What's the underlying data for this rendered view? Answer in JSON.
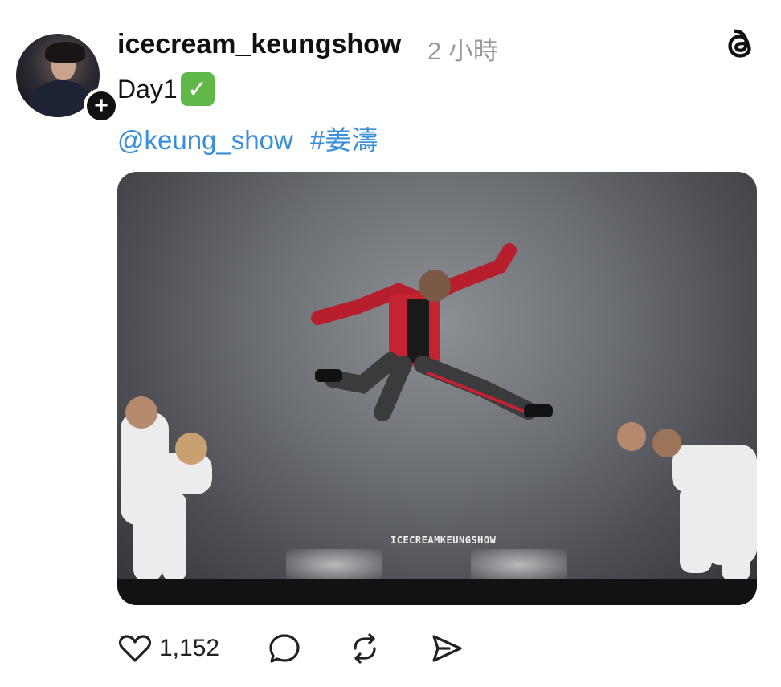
{
  "post": {
    "username": "icecream_keungshow",
    "timestamp": "2 小時",
    "caption": "Day1",
    "caption_emoji": "✅",
    "tags": [
      "@keung_show",
      "#姜濤"
    ],
    "image": {
      "watermark": "ICECREAMKEUNGSHOW"
    },
    "likes": "1,152"
  },
  "icons": {
    "follow": "plus-icon",
    "app": "threads-icon",
    "like": "heart-icon",
    "comment": "comment-icon",
    "repost": "repost-icon",
    "share": "share-icon"
  }
}
